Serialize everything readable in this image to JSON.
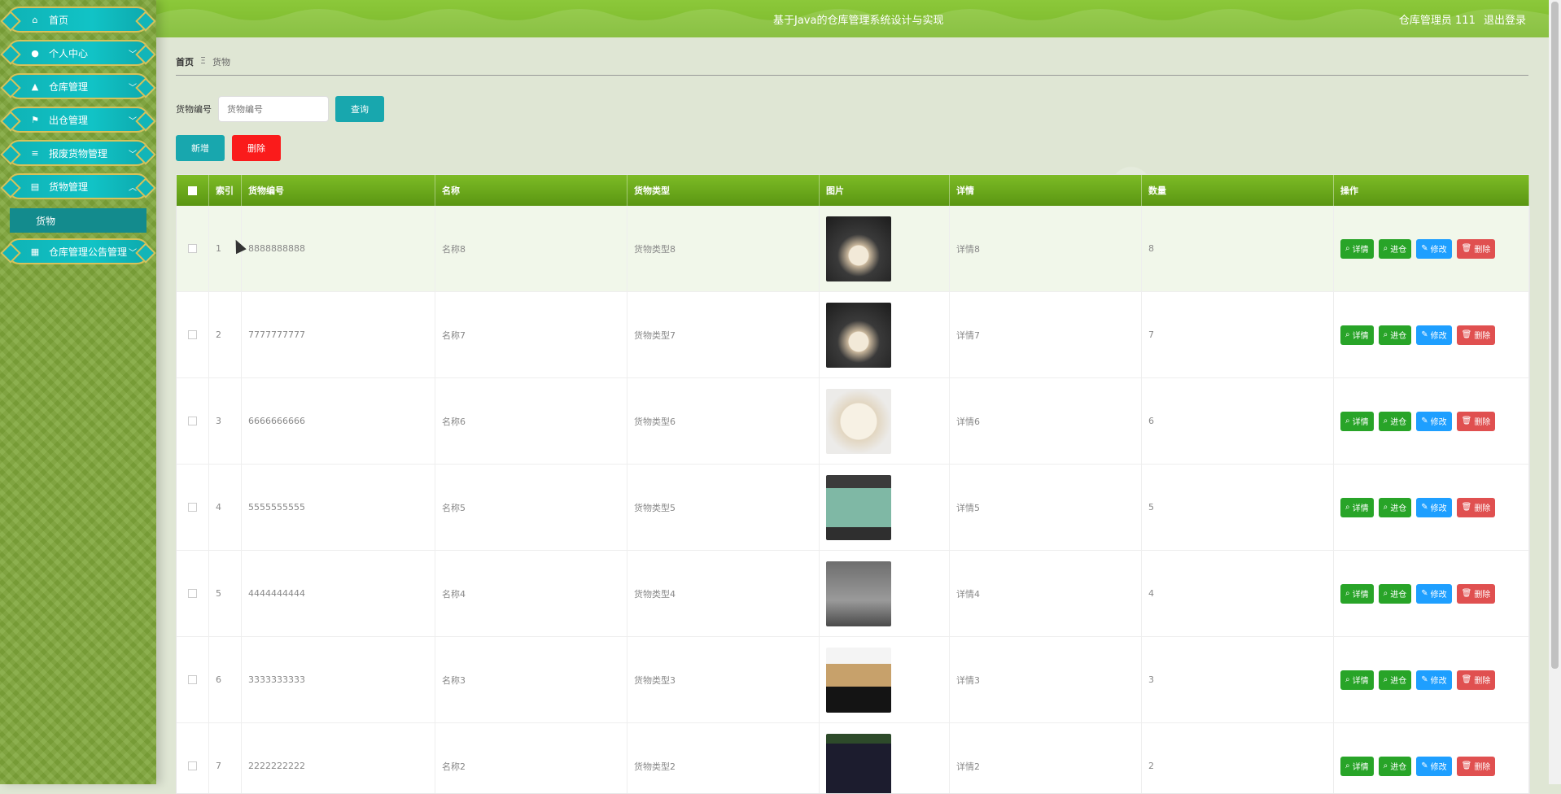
{
  "header": {
    "title": "基于Java的仓库管理系统设计与实现",
    "user": "仓库管理员 111",
    "logout": "退出登录"
  },
  "sidebar": {
    "items": [
      {
        "label": "首页",
        "icon": "home-icon"
      },
      {
        "label": "个人中心",
        "icon": "user-icon"
      },
      {
        "label": "仓库管理",
        "icon": "warehouse-icon"
      },
      {
        "label": "出仓管理",
        "icon": "flag-icon"
      },
      {
        "label": "报废货物管理",
        "icon": "list-icon"
      },
      {
        "label": "货物管理",
        "icon": "clipboard-icon"
      },
      {
        "label": "仓库管理公告管理",
        "icon": "grid-icon"
      }
    ],
    "sub_item": "货物"
  },
  "breadcrumb": {
    "home": "首页",
    "sep": "Ξ",
    "current": "货物"
  },
  "search": {
    "label": "货物编号",
    "placeholder": "货物编号",
    "button": "查询"
  },
  "toolbar": {
    "add": "新增",
    "delete": "删除"
  },
  "table": {
    "columns": [
      "索引",
      "货物编号",
      "名称",
      "货物类型",
      "图片",
      "详情",
      "数量",
      "操作"
    ],
    "rows": [
      {
        "index": "1",
        "code": "8888888888",
        "name": "名称8",
        "type": "货物类型8",
        "detail": "详情8",
        "qty": "8"
      },
      {
        "index": "2",
        "code": "7777777777",
        "name": "名称7",
        "type": "货物类型7",
        "detail": "详情7",
        "qty": "7"
      },
      {
        "index": "3",
        "code": "6666666666",
        "name": "名称6",
        "type": "货物类型6",
        "detail": "详情6",
        "qty": "6"
      },
      {
        "index": "4",
        "code": "5555555555",
        "name": "名称5",
        "type": "货物类型5",
        "detail": "详情5",
        "qty": "5"
      },
      {
        "index": "5",
        "code": "4444444444",
        "name": "名称4",
        "type": "货物类型4",
        "detail": "详情4",
        "qty": "4"
      },
      {
        "index": "6",
        "code": "3333333333",
        "name": "名称3",
        "type": "货物类型3",
        "detail": "详情3",
        "qty": "3"
      },
      {
        "index": "7",
        "code": "2222222222",
        "name": "名称2",
        "type": "货物类型2",
        "detail": "详情2",
        "qty": "2"
      }
    ],
    "actions": {
      "detail": "详情",
      "in": "进仓",
      "edit": "修改",
      "delete": "删除"
    }
  },
  "colors": {
    "accent": "#18a7ae",
    "header": "#7ab82a",
    "danger": "#fa1b1b"
  }
}
